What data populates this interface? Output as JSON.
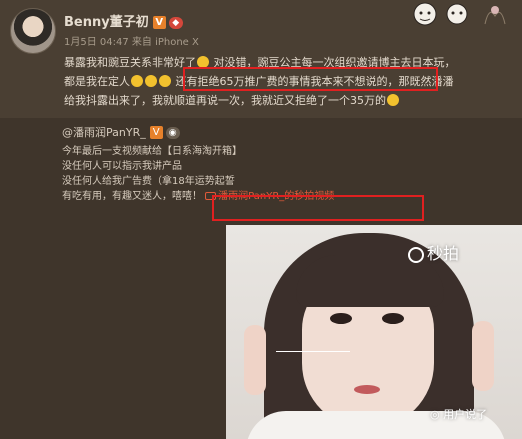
{
  "post": {
    "author": "Benny董子初",
    "vbadge": "V",
    "meta": "1月5日 04:47 来自 iPhone X",
    "lines": [
      "暴露我和豌豆关系非常好了",
      "对没错，豌豆公主每一次组织邀请博主去日本玩，",
      "都是我在定人",
      "还有拒绝65万推广费的事情我本来不想说的，那既然潘潘",
      "给我抖露出来了，我就顺道再说一次，我就近又拒绝了一个35万的"
    ]
  },
  "repost": {
    "author": "@潘雨润PanYR_",
    "vbadge": "V",
    "lines": [
      "今年最后一支视频献给【日系海淘开箱】",
      "没任何人可以指示我讲产品",
      "没任何人给我广告费（拿18年运势起誓",
      "有吃有用，有趣又迷人，嘻嘻！"
    ],
    "video_link": "潘雨润PanYR_的秒拍视频"
  },
  "video": {
    "watermark": "秒拍",
    "corner_watermark": "用户说了"
  },
  "colors": {
    "highlight": "#e02020",
    "link": "#e05a3a",
    "vbadge": "#e7812b"
  }
}
